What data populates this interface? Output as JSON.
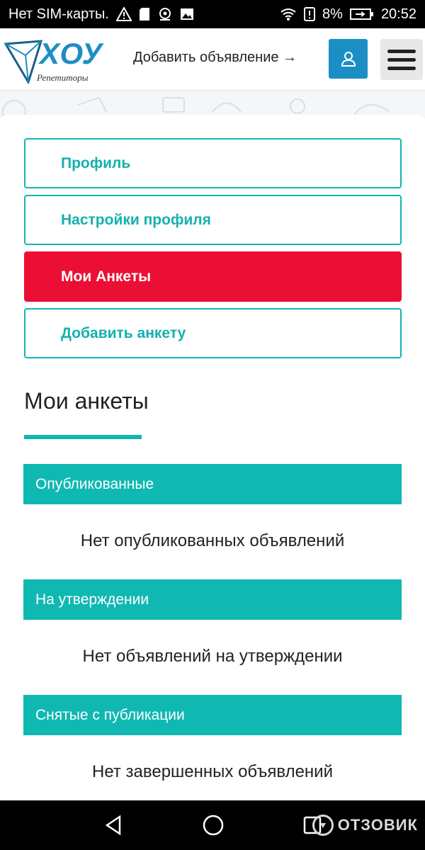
{
  "status_bar": {
    "carrier": "Нет SIM-карты.",
    "battery": "8%",
    "time": "20:52"
  },
  "header": {
    "logo_word": "ХОУ",
    "logo_sub": "Репетиторы",
    "add_listing": "Добавить объявление →",
    "accent_color": "#1b8fc4"
  },
  "menu": {
    "items": [
      {
        "label": "Профиль",
        "active": false
      },
      {
        "label": "Настройки профиля",
        "active": false
      },
      {
        "label": "Мои Анкеты",
        "active": true
      },
      {
        "label": "Добавить анкету",
        "active": false
      }
    ],
    "active_color": "#ec0f35",
    "teal_color": "#10b8b2"
  },
  "main": {
    "title": "Мои анкеты",
    "groups": [
      {
        "header": "Опубликованные",
        "empty": "Нет опубликованных объявлений"
      },
      {
        "header": "На утверждении",
        "empty": "Нет объявлений на утверждении"
      },
      {
        "header": "Снятые с публикации",
        "empty": "Нет завершенных объявлений"
      }
    ]
  },
  "watermark": {
    "text": "ОТЗОВИК"
  }
}
